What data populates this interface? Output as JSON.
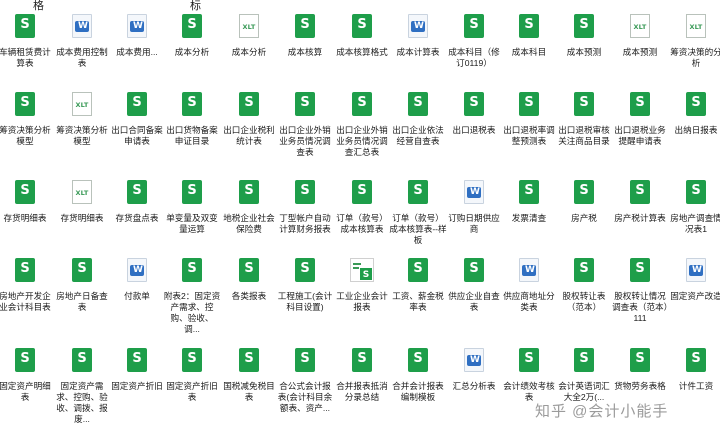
{
  "cut_labels": [
    "格",
    "标"
  ],
  "watermark": "知乎 @会计小能手",
  "files": [
    {
      "name": "车辆租赁费计算表",
      "type": "s"
    },
    {
      "name": "成本费用控制表",
      "type": "w"
    },
    {
      "name": "成本费用...",
      "type": "w"
    },
    {
      "name": "成本分析",
      "type": "s"
    },
    {
      "name": "成本分析",
      "type": "x"
    },
    {
      "name": "成本核算",
      "type": "s"
    },
    {
      "name": "成本核算格式",
      "type": "s"
    },
    {
      "name": "成本计算表",
      "type": "w"
    },
    {
      "name": "成本科目（修订0119）",
      "type": "s"
    },
    {
      "name": "成本科目",
      "type": "s"
    },
    {
      "name": "成本预测",
      "type": "s"
    },
    {
      "name": "成本预测",
      "type": "x"
    },
    {
      "name": "筹资决策的分析",
      "type": "x"
    },
    {
      "name": "筹资决策分析模型",
      "type": "s"
    },
    {
      "name": "筹资决策分析模型",
      "type": "x"
    },
    {
      "name": "出口合同备案申请表",
      "type": "s"
    },
    {
      "name": "出口货物备案申证目录",
      "type": "s"
    },
    {
      "name": "出口企业税利统计表",
      "type": "s"
    },
    {
      "name": "出口企业外销业务员情况调查表",
      "type": "s"
    },
    {
      "name": "出口企业外销业务员情况调查汇总表",
      "type": "s"
    },
    {
      "name": "出口企业依法经营自查表",
      "type": "s"
    },
    {
      "name": "出口退税表",
      "type": "s"
    },
    {
      "name": "出口退税率调整预测表",
      "type": "s"
    },
    {
      "name": "出口退税审核关注商品目录",
      "type": "s"
    },
    {
      "name": "出口退税业务提醒申请表",
      "type": "s"
    },
    {
      "name": "出纳日报表",
      "type": "s"
    },
    {
      "name": "存货明细表",
      "type": "s"
    },
    {
      "name": "存货明细表",
      "type": "x"
    },
    {
      "name": "存货盘点表",
      "type": "s"
    },
    {
      "name": "单变量及双变量运算",
      "type": "s"
    },
    {
      "name": "地税企业社会保险费",
      "type": "s"
    },
    {
      "name": "丁型帐户自动计算财务报表",
      "type": "s"
    },
    {
      "name": "订单（款号）成本核算表",
      "type": "s"
    },
    {
      "name": "订单（款号）成本核算表--样板",
      "type": "s"
    },
    {
      "name": "订购日期供应商",
      "type": "w"
    },
    {
      "name": "发票清查",
      "type": "s"
    },
    {
      "name": "房产税",
      "type": "s"
    },
    {
      "name": "房产税计算表",
      "type": "s"
    },
    {
      "name": "房地产调查情况表1",
      "type": "s"
    },
    {
      "name": "房地产开发企业会计科目表",
      "type": "s"
    },
    {
      "name": "房地产日备查表",
      "type": "s"
    },
    {
      "name": "付款单",
      "type": "w"
    },
    {
      "name": "附表2：固定资产需求、控购、验收、调...",
      "type": "s"
    },
    {
      "name": "各类报表",
      "type": "s"
    },
    {
      "name": "工程施工(会计科目设置)",
      "type": "s"
    },
    {
      "name": "工业企业会计报表",
      "type": "t"
    },
    {
      "name": "工资、薪金税率表",
      "type": "s"
    },
    {
      "name": "供应企业自查表",
      "type": "s"
    },
    {
      "name": "供应商地址分类表",
      "type": "w"
    },
    {
      "name": "股权转让表（范本）",
      "type": "s"
    },
    {
      "name": "股权转让情况调查表（范本）111",
      "type": "s"
    },
    {
      "name": "固定资产改造",
      "type": "w"
    },
    {
      "name": "固定资产明细表",
      "type": "s"
    },
    {
      "name": "固定资产需求、控购、验收、调拨、报废...",
      "type": "s"
    },
    {
      "name": "固定资产折旧",
      "type": "s"
    },
    {
      "name": "固定资产折旧表",
      "type": "s"
    },
    {
      "name": "国税减免税目表",
      "type": "s"
    },
    {
      "name": "合公式会计报表(会计科目余额表、资产...",
      "type": "s"
    },
    {
      "name": "合并报表抵消分录总结",
      "type": "s"
    },
    {
      "name": "合并会计报表编制模板",
      "type": "s"
    },
    {
      "name": "汇总分析表",
      "type": "w"
    },
    {
      "name": "会计绩效考核表",
      "type": "s"
    },
    {
      "name": "会计英语词汇大全2万(...",
      "type": "s"
    },
    {
      "name": "货物劳务表格",
      "type": "s"
    },
    {
      "name": "计件工资",
      "type": "s"
    }
  ]
}
